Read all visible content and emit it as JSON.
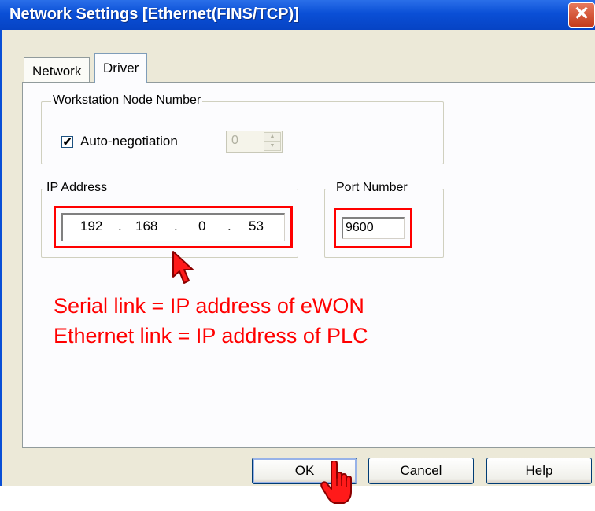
{
  "window": {
    "title": "Network Settings [Ethernet(FINS/TCP)]",
    "close_glyph": "✕"
  },
  "tabs": [
    {
      "label": "Network"
    },
    {
      "label": "Driver"
    }
  ],
  "node_group": {
    "legend": "Workstation Node Number",
    "auto_label": "Auto-negotiation",
    "auto_checked": true,
    "check_glyph": "✔",
    "node_value": "0"
  },
  "ip_group": {
    "legend": "IP Address",
    "octets": [
      "192",
      "168",
      "0",
      "53"
    ],
    "dot": "."
  },
  "port_group": {
    "legend": "Port Number",
    "value": "9600"
  },
  "annotations": [
    "Serial link = IP address of eWON",
    "Ethernet link = IP address of PLC"
  ],
  "buttons": {
    "ok": "OK",
    "cancel": "Cancel",
    "help": "Help"
  },
  "icons": {
    "cursor": "arrow-cursor-icon",
    "hand": "hand-pointer-icon"
  },
  "colors": {
    "titlebar": "#0a4fd6",
    "highlight": "#ff0000",
    "dialog_bg": "#ece9d8"
  }
}
